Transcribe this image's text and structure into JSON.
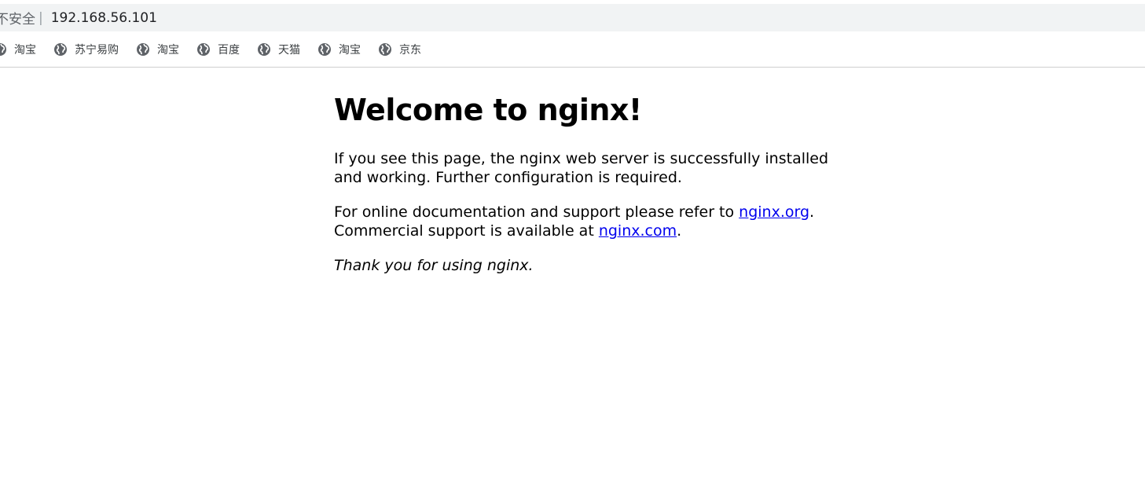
{
  "address_bar": {
    "security_label": "不安全",
    "separator": "|",
    "url": "192.168.56.101"
  },
  "bookmarks": [
    {
      "label": "淘宝",
      "icon": "globe-icon"
    },
    {
      "label": "苏宁易购",
      "icon": "globe-icon"
    },
    {
      "label": "淘宝",
      "icon": "globe-icon"
    },
    {
      "label": "百度",
      "icon": "globe-icon"
    },
    {
      "label": "天猫",
      "icon": "globe-icon"
    },
    {
      "label": "淘宝",
      "icon": "globe-icon"
    },
    {
      "label": "京东",
      "icon": "globe-icon"
    }
  ],
  "page": {
    "title": "Welcome to nginx!",
    "paragraph1": "If you see this page, the nginx web server is successfully installed and working. Further configuration is required.",
    "paragraph2_part1": "For online documentation and support please refer to ",
    "link_org": "nginx.org",
    "paragraph2_part2": ".",
    "paragraph2_part3": "Commercial support is available at ",
    "link_com": "nginx.com",
    "paragraph2_part4": ".",
    "paragraph3": "Thank you for using nginx."
  },
  "colors": {
    "link": "#0000ee",
    "address_bar_bg": "#f1f3f4"
  }
}
